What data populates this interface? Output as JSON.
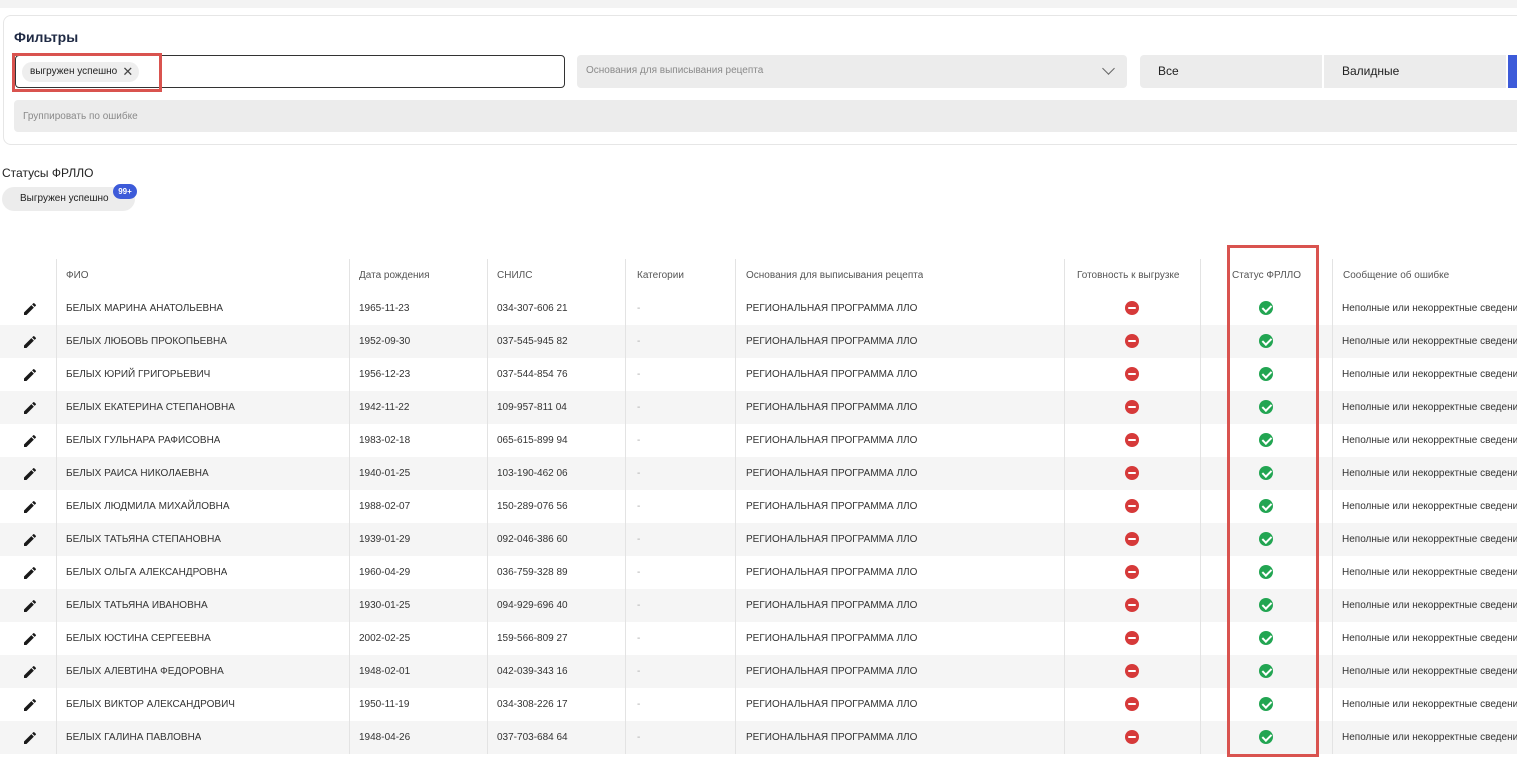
{
  "filters": {
    "title": "Фильтры",
    "status_chip": "выгружен успешно",
    "basis_placeholder": "Основания для выписывания рецепта",
    "validity_all": "Все",
    "validity_valid": "Валидные",
    "group_placeholder": "Группировать по ошибке"
  },
  "statuses": {
    "title": "Статусы ФРЛЛО",
    "tab_label": "Выгружен успешно",
    "tab_count": "99+"
  },
  "colors": {
    "accent": "#3d5bd9",
    "ok": "#22a552",
    "error": "#d63a3a",
    "highlight": "#d9534f"
  },
  "table": {
    "columns": [
      "ФИО",
      "Дата рождения",
      "СНИЛС",
      "Категории",
      "Основания для выписывания рецепта",
      "Готовность к выгрузке",
      "Статус ФРЛЛО",
      "Сообщение об ошибке"
    ],
    "rows": [
      {
        "name": "БЕЛЫХ МАРИНА АНАТОЛЬЕВНА",
        "birth": "1965-11-23",
        "snils": "034-307-606 21",
        "category": "-",
        "basis": "РЕГИОНАЛЬНАЯ ПРОГРАММА ЛЛО",
        "ready": "minus-circle-icon",
        "frllo": "check-circle-icon",
        "message": "Неполные или некорректные сведения"
      },
      {
        "name": "БЕЛЫХ ЛЮБОВЬ ПРОКОПЬЕВНА",
        "birth": "1952-09-30",
        "snils": "037-545-945 82",
        "category": "-",
        "basis": "РЕГИОНАЛЬНАЯ ПРОГРАММА ЛЛО",
        "ready": "minus-circle-icon",
        "frllo": "check-circle-icon",
        "message": "Неполные или некорректные сведения"
      },
      {
        "name": "БЕЛЫХ ЮРИЙ ГРИГОРЬЕВИЧ",
        "birth": "1956-12-23",
        "snils": "037-544-854 76",
        "category": "-",
        "basis": "РЕГИОНАЛЬНАЯ ПРОГРАММА ЛЛО",
        "ready": "minus-circle-icon",
        "frllo": "check-circle-icon",
        "message": "Неполные или некорректные сведения"
      },
      {
        "name": "БЕЛЫХ ЕКАТЕРИНА СТЕПАНОВНА",
        "birth": "1942-11-22",
        "snils": "109-957-811 04",
        "category": "-",
        "basis": "РЕГИОНАЛЬНАЯ ПРОГРАММА ЛЛО",
        "ready": "minus-circle-icon",
        "frllo": "check-circle-icon",
        "message": "Неполные или некорректные сведения"
      },
      {
        "name": "БЕЛЫХ ГУЛЬНАРА РАФИСОВНА",
        "birth": "1983-02-18",
        "snils": "065-615-899 94",
        "category": "-",
        "basis": "РЕГИОНАЛЬНАЯ ПРОГРАММА ЛЛО",
        "ready": "minus-circle-icon",
        "frllo": "check-circle-icon",
        "message": "Неполные или некорректные сведения"
      },
      {
        "name": "БЕЛЫХ РАИСА НИКОЛАЕВНА",
        "birth": "1940-01-25",
        "snils": "103-190-462 06",
        "category": "-",
        "basis": "РЕГИОНАЛЬНАЯ ПРОГРАММА ЛЛО",
        "ready": "minus-circle-icon",
        "frllo": "check-circle-icon",
        "message": "Неполные или некорректные сведения"
      },
      {
        "name": "БЕЛЫХ ЛЮДМИЛА МИХАЙЛОВНА",
        "birth": "1988-02-07",
        "snils": "150-289-076 56",
        "category": "-",
        "basis": "РЕГИОНАЛЬНАЯ ПРОГРАММА ЛЛО",
        "ready": "minus-circle-icon",
        "frllo": "check-circle-icon",
        "message": "Неполные или некорректные сведения"
      },
      {
        "name": "БЕЛЫХ ТАТЬЯНА СТЕПАНОВНА",
        "birth": "1939-01-29",
        "snils": "092-046-386 60",
        "category": "-",
        "basis": "РЕГИОНАЛЬНАЯ ПРОГРАММА ЛЛО",
        "ready": "minus-circle-icon",
        "frllo": "check-circle-icon",
        "message": "Неполные или некорректные сведения"
      },
      {
        "name": "БЕЛЫХ ОЛЬГА АЛЕКСАНДРОВНА",
        "birth": "1960-04-29",
        "snils": "036-759-328 89",
        "category": "-",
        "basis": "РЕГИОНАЛЬНАЯ ПРОГРАММА ЛЛО",
        "ready": "minus-circle-icon",
        "frllo": "check-circle-icon",
        "message": "Неполные или некорректные сведения"
      },
      {
        "name": "БЕЛЫХ ТАТЬЯНА ИВАНОВНА",
        "birth": "1930-01-25",
        "snils": "094-929-696 40",
        "category": "-",
        "basis": "РЕГИОНАЛЬНАЯ ПРОГРАММА ЛЛО",
        "ready": "minus-circle-icon",
        "frllo": "check-circle-icon",
        "message": "Неполные или некорректные сведения"
      },
      {
        "name": "БЕЛЫХ ЮСТИНА СЕРГЕЕВНА",
        "birth": "2002-02-25",
        "snils": "159-566-809 27",
        "category": "-",
        "basis": "РЕГИОНАЛЬНАЯ ПРОГРАММА ЛЛО",
        "ready": "minus-circle-icon",
        "frllo": "check-circle-icon",
        "message": "Неполные или некорректные сведения"
      },
      {
        "name": "БЕЛЫХ АЛЕВТИНА ФЕДОРОВНА",
        "birth": "1948-02-01",
        "snils": "042-039-343 16",
        "category": "-",
        "basis": "РЕГИОНАЛЬНАЯ ПРОГРАММА ЛЛО",
        "ready": "minus-circle-icon",
        "frllo": "check-circle-icon",
        "message": "Неполные или некорректные сведения"
      },
      {
        "name": "БЕЛЫХ ВИКТОР АЛЕКСАНДРОВИЧ",
        "birth": "1950-11-19",
        "snils": "034-308-226 17",
        "category": "-",
        "basis": "РЕГИОНАЛЬНАЯ ПРОГРАММА ЛЛО",
        "ready": "minus-circle-icon",
        "frllo": "check-circle-icon",
        "message": "Неполные или некорректные сведения"
      },
      {
        "name": "БЕЛЫХ ГАЛИНА ПАВЛОВНА",
        "birth": "1948-04-26",
        "snils": "037-703-684 64",
        "category": "-",
        "basis": "РЕГИОНАЛЬНАЯ ПРОГРАММА ЛЛО",
        "ready": "minus-circle-icon",
        "frllo": "check-circle-icon",
        "message": "Неполные или некорректные сведения"
      }
    ]
  }
}
